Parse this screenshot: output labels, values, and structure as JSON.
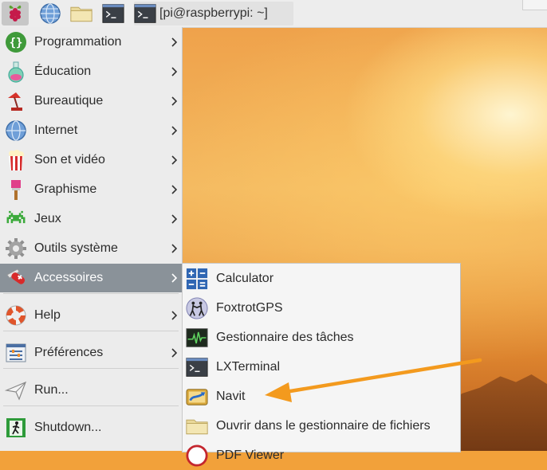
{
  "taskbar": {
    "menu_icon": "raspberry-icon",
    "browser_icon": "globe-icon",
    "files_icon": "folder-icon",
    "terminal_icon": "terminal-icon",
    "task_title": "[pi@raspberrypi: ~]"
  },
  "main_menu": {
    "items": [
      {
        "label": "Programmation",
        "icon": "code-braces-icon"
      },
      {
        "label": "Éducation",
        "icon": "flask-icon"
      },
      {
        "label": "Bureautique",
        "icon": "desk-lamp-icon"
      },
      {
        "label": "Internet",
        "icon": "globe-icon"
      },
      {
        "label": "Son et vidéo",
        "icon": "popcorn-icon"
      },
      {
        "label": "Graphisme",
        "icon": "paintbrush-icon"
      },
      {
        "label": "Jeux",
        "icon": "space-invader-icon"
      },
      {
        "label": "Outils système",
        "icon": "gear-icon"
      },
      {
        "label": "Accessoires",
        "icon": "swiss-knife-icon"
      },
      {
        "label": "Help",
        "icon": "lifebuoy-icon"
      },
      {
        "label": "Préférences",
        "icon": "preferences-icon"
      },
      {
        "label": "Run...",
        "icon": "paper-plane-icon"
      },
      {
        "label": "Shutdown...",
        "icon": "exit-person-icon"
      }
    ],
    "active": "Accessoires"
  },
  "accessories_menu": {
    "items": [
      {
        "label": "Calculator",
        "icon": "calculator-icon"
      },
      {
        "label": "FoxtrotGPS",
        "icon": "foxtrotgps-icon"
      },
      {
        "label": "Gestionnaire des tâches",
        "icon": "task-manager-icon"
      },
      {
        "label": "LXTerminal",
        "icon": "terminal-icon"
      },
      {
        "label": "Navit",
        "icon": "navit-icon"
      },
      {
        "label": "Ouvrir dans le gestionnaire de fichiers",
        "icon": "folder-icon"
      },
      {
        "label": "PDF Viewer",
        "icon": "pdf-icon"
      }
    ]
  },
  "annotation": {
    "type": "arrow",
    "points_to": "Navit",
    "color": "#f39a1e"
  },
  "colors": {
    "active_row": "#8a9299",
    "menu_bg": "#ececec",
    "accent_arrow": "#f39a1e"
  }
}
